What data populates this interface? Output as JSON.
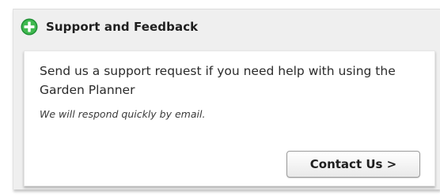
{
  "panel": {
    "title": "Support and Feedback",
    "header_icon": "plus-circle-icon",
    "accent_color": "#1fa03a"
  },
  "card": {
    "message": "Send us a support request if you need help with using the Garden Planner",
    "note": "We will respond quickly by email.",
    "contact_button_label": "Contact Us >"
  }
}
